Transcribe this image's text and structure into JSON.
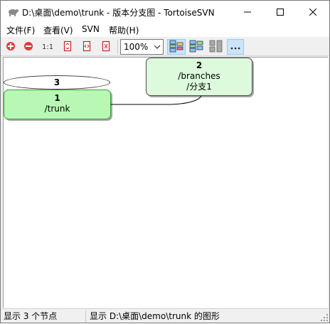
{
  "window": {
    "title": "D:\\桌面\\demo\\trunk - 版本分支图 - TortoiseSVN"
  },
  "menu": {
    "file": "文件(F)",
    "view": "查看(V)",
    "svn": "SVN",
    "help": "帮助(H)"
  },
  "toolbar": {
    "zoom_value": "100%",
    "icons": [
      "zoom-in-icon",
      "zoom-out-icon",
      "zoom-100-icon",
      "zoom-fit-height-icon",
      "zoom-fit-all-icon",
      "zoom-fit-width-icon",
      "group-branches-icon",
      "show-head-icon",
      "fold-tags-icon",
      "more-options-icon"
    ]
  },
  "graph": {
    "ellipse_label": "3",
    "nodes": [
      {
        "rev": "1",
        "path": "/trunk",
        "extra": ""
      },
      {
        "rev": "2",
        "path": "/branches",
        "extra": "/分支1"
      }
    ],
    "colors": {
      "trunk_fill": "#b8f7b4",
      "branch_fill": "#ddfbdc"
    }
  },
  "status": {
    "left": "显示 3 个节点",
    "right": "显示 D:\\桌面\\demo\\trunk 的图形"
  }
}
